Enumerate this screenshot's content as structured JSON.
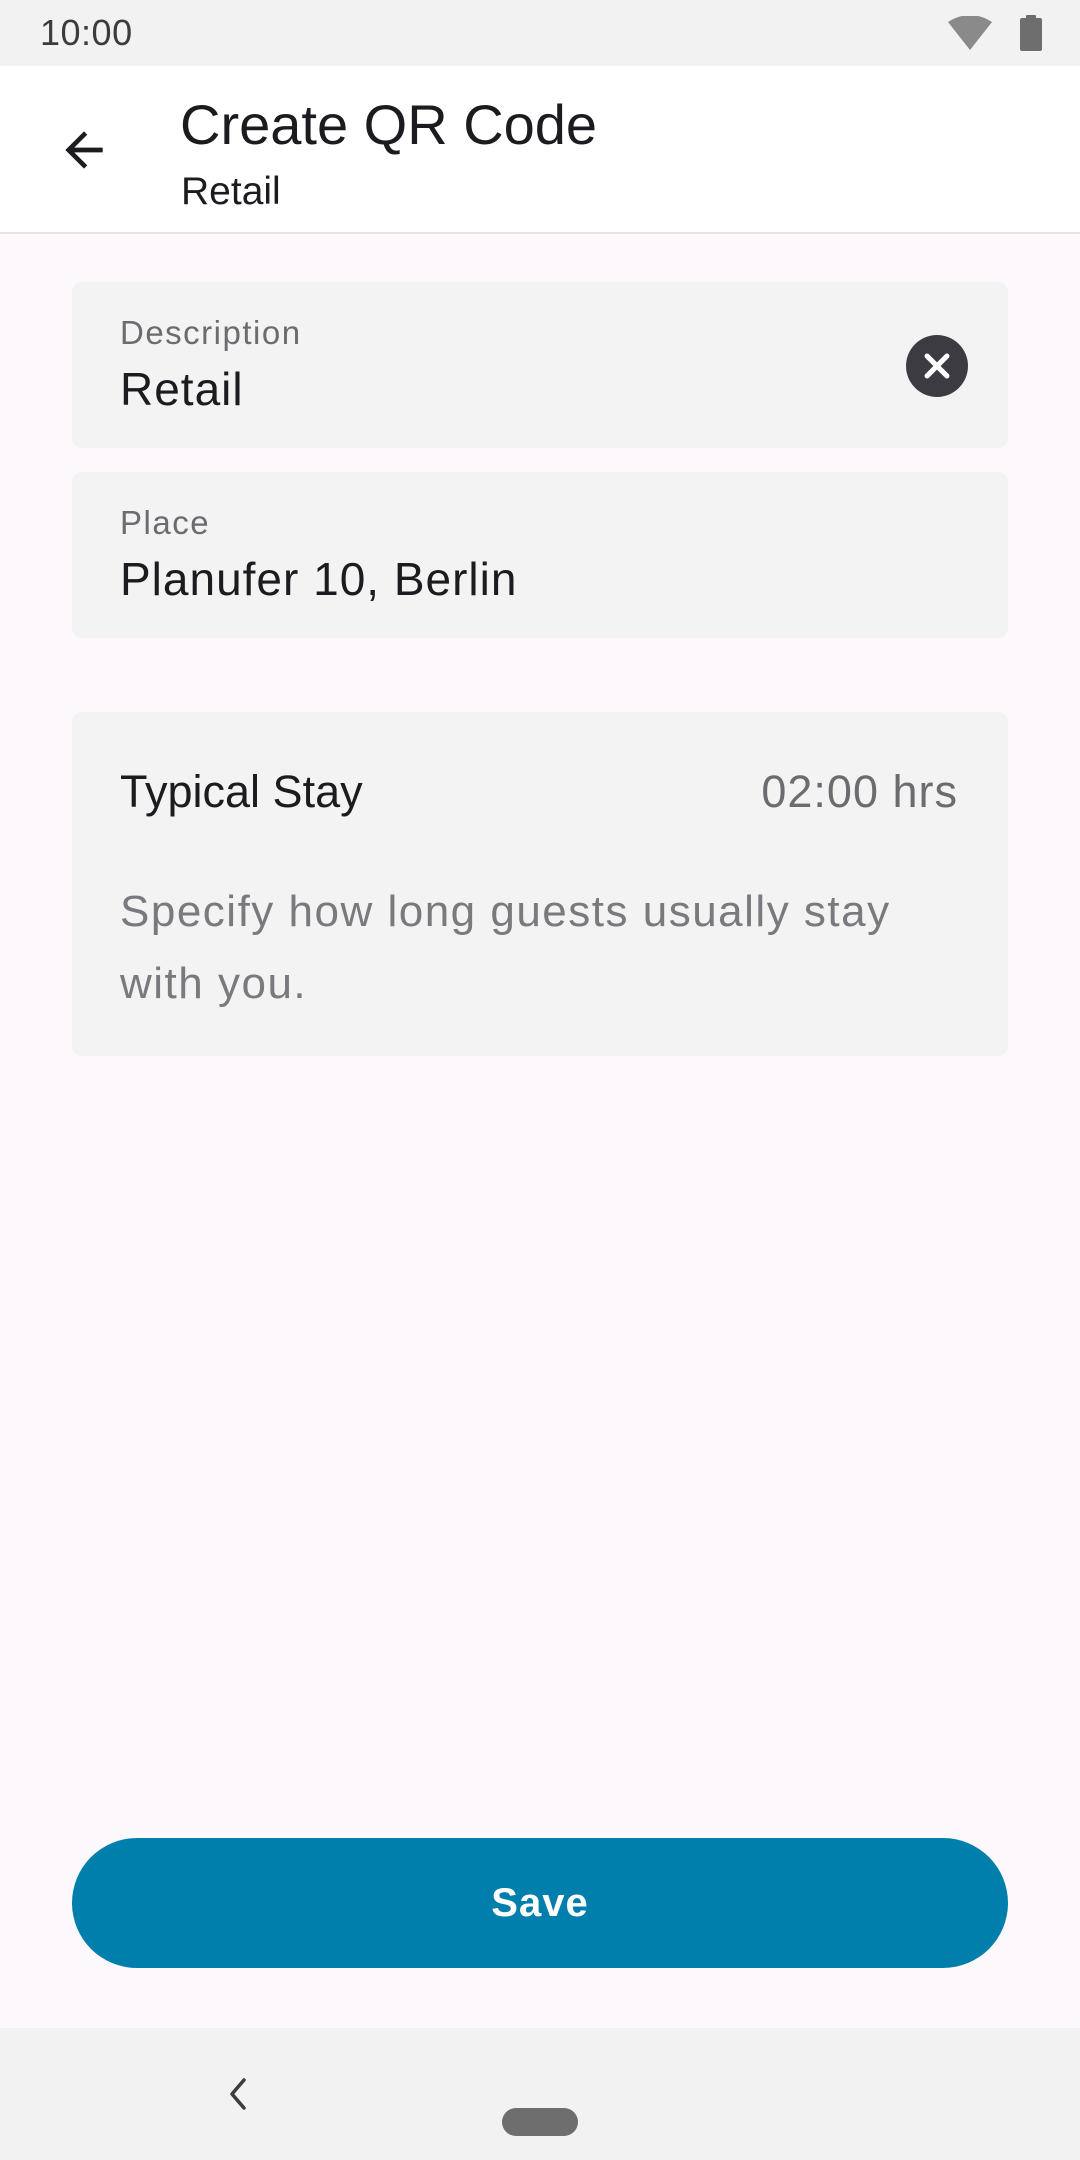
{
  "status_bar": {
    "time": "10:00",
    "icons": [
      "wifi-icon",
      "battery-icon"
    ]
  },
  "app_bar": {
    "title": "Create QR Code",
    "subtitle": "Retail",
    "back_icon": "arrow-back-icon"
  },
  "form": {
    "description": {
      "label": "Description",
      "value": "Retail",
      "clear_icon": "clear-icon"
    },
    "place": {
      "label": "Place",
      "value": "Planufer 10, Berlin"
    },
    "typical_stay": {
      "title": "Typical Stay",
      "value": "02:00 hrs",
      "description": "Specify how long guests usually stay with you."
    }
  },
  "actions": {
    "save_label": "Save"
  },
  "colors": {
    "primary": "#007fad",
    "background": "#fcf8fb",
    "field_background": "#f3f3f3"
  },
  "navigation_bar": {
    "icons": [
      "nav-back-icon",
      "nav-home-pill"
    ]
  }
}
